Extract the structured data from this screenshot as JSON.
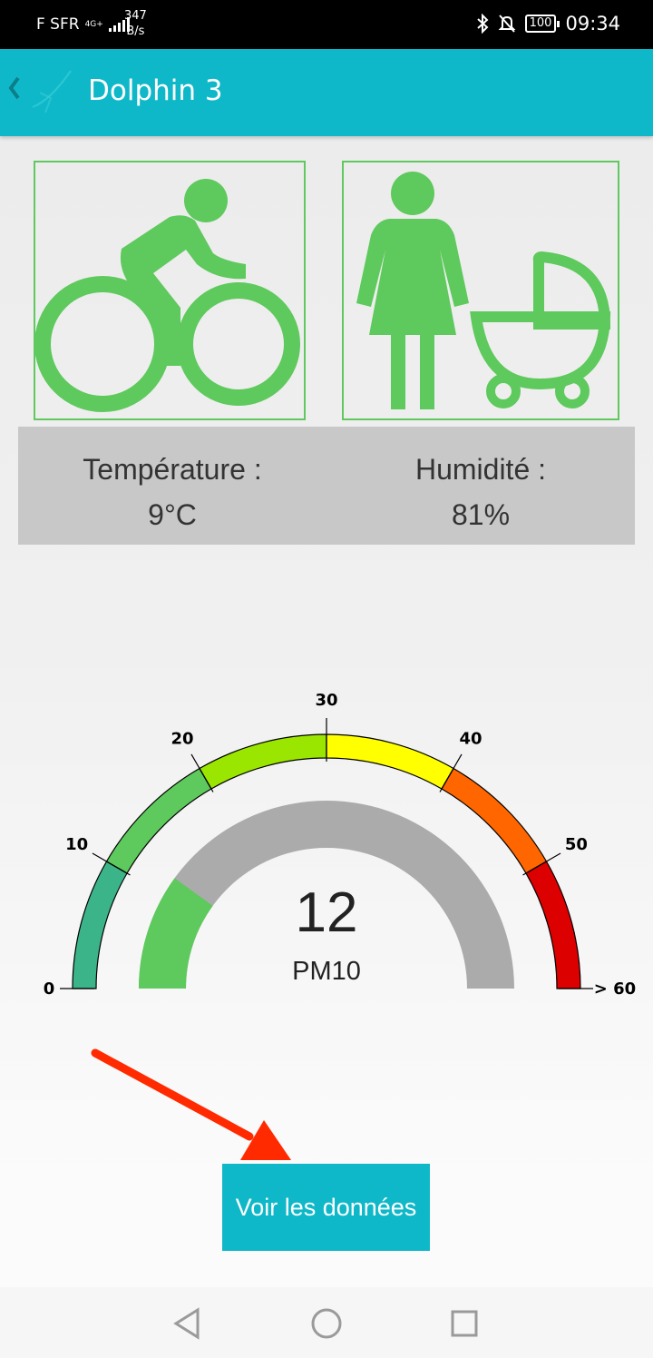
{
  "status_bar": {
    "carrier": "F SFR",
    "network_type": "4G+",
    "speed_value": "347",
    "speed_unit": "B/s",
    "battery": "100",
    "time": "09:34"
  },
  "app_bar": {
    "back_icon": "chevron-left-icon",
    "title": "Dolphin 3"
  },
  "activity_tiles": [
    {
      "icon": "cyclist-icon"
    },
    {
      "icon": "woman-with-stroller-icon"
    }
  ],
  "conditions": {
    "temperature_label": "Température :",
    "temperature_value": "9°C",
    "humidity_label": "Humidité :",
    "humidity_value": "81%"
  },
  "gauge": {
    "value": "12",
    "numeric_value": 12,
    "max": 60,
    "label": "PM10",
    "scale_labels": [
      "0",
      "10",
      "20",
      "30",
      "40",
      "50",
      "> 60"
    ],
    "bands": [
      {
        "from": 0,
        "to": 10,
        "color": "#3cb48a"
      },
      {
        "from": 10,
        "to": 20,
        "color": "#5ec95c"
      },
      {
        "from": 20,
        "to": 30,
        "color": "#9be600"
      },
      {
        "from": 30,
        "to": 40,
        "color": "#ffff00"
      },
      {
        "from": 40,
        "to": 50,
        "color": "#ff6600"
      },
      {
        "from": 50,
        "to": 60,
        "color": "#dd0000"
      }
    ],
    "fill_color": "#5ec95c",
    "track_color": "#ababab"
  },
  "action_button": {
    "label": "Voir les données"
  },
  "colors": {
    "primary": "#0fb8c8",
    "icon_green": "#5ec95c",
    "panel_gray": "#c8c8c8",
    "arrow_red": "#ff2a00"
  }
}
